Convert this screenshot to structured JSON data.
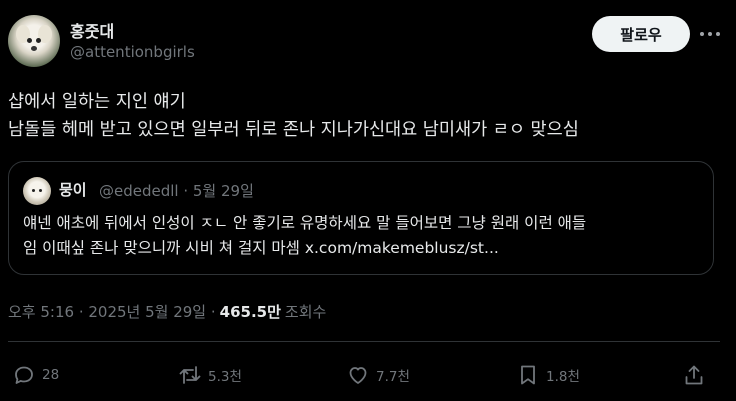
{
  "author": {
    "name": "홍줏대",
    "handle": "@attentionbgirls",
    "follow_label": "팔로우"
  },
  "tweet": {
    "text": "샵에서 일하는 지인 얘기\n남돌들 헤메 받고 있으면 일부러 뒤로 존나 지나가신대요 남미새가 ㄹㅇ 맞으심"
  },
  "quote": {
    "name": "뭉이",
    "meta": "@edededll · 5월 29일",
    "text": "얘넨 애초에 뒤에서 인성이 ㅈㄴ 안 좋기로 유명하세요 말 들어보면 그냥 원래 이런 애들\n임 이때싶 존나 맞으니까 시비 쳐 걸지 마셈 x.com/makemeblusz/st..."
  },
  "meta": {
    "time_date": "오후 5:16 · 2025년 5월 29일 ·",
    "views_count": "465.5만",
    "views_label": "조회수"
  },
  "actions": {
    "replies": "28",
    "retweets": "5.3천",
    "likes": "7.7천",
    "bookmarks": "1.8천"
  },
  "colors": {
    "background": "#000000",
    "text": "#e7e9ea",
    "muted": "#71767b",
    "border": "#2f3336",
    "follow_bg": "#eff3f4"
  },
  "icons": [
    "more-icon",
    "reply-icon",
    "retweet-icon",
    "like-icon",
    "bookmark-icon",
    "share-icon"
  ]
}
